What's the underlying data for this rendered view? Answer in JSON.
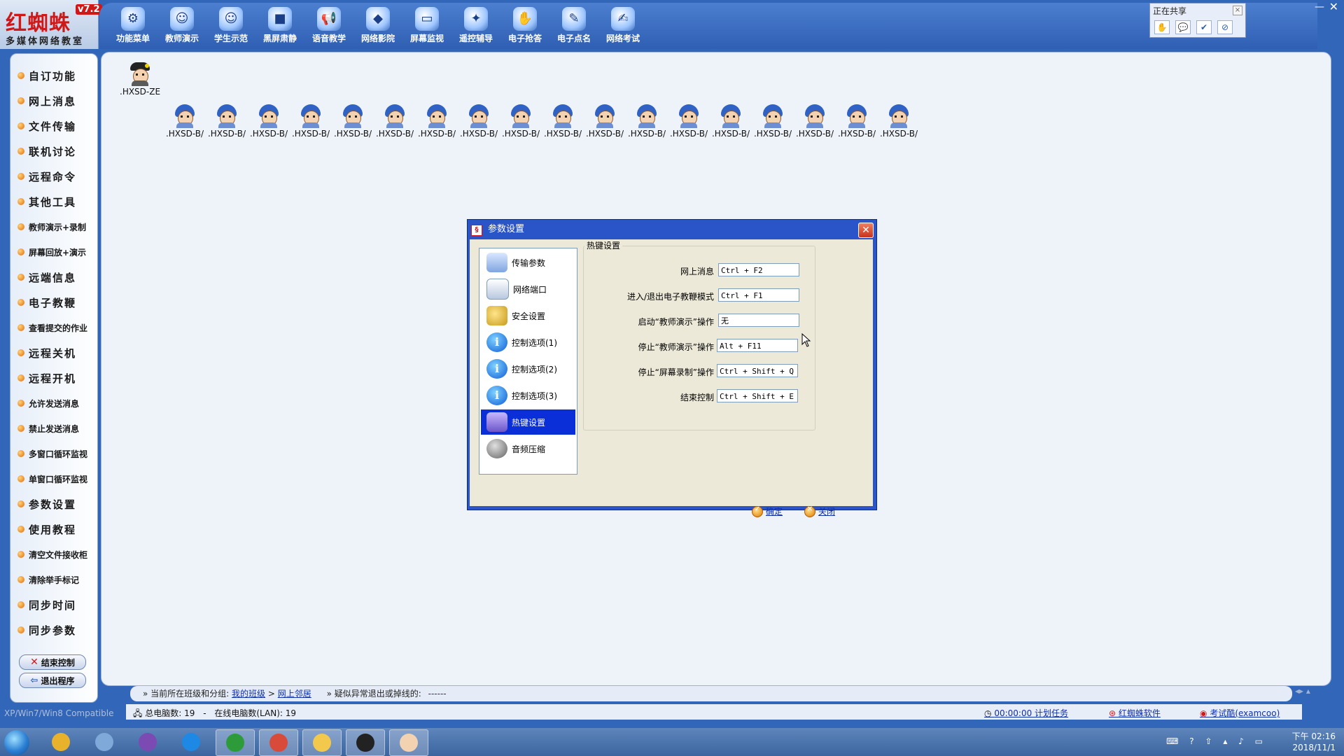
{
  "brand": {
    "title": "红蜘蛛",
    "version": "v7.2",
    "subtitle": "多媒体网络教室"
  },
  "toolbar": [
    {
      "label": "功能菜单",
      "icon": "gear-icon",
      "glyph": "⚙"
    },
    {
      "label": "教师演示",
      "icon": "teacher-icon",
      "glyph": "☺"
    },
    {
      "label": "学生示范",
      "icon": "students-icon",
      "glyph": "☺"
    },
    {
      "label": "黑屏肃静",
      "icon": "black-screen-icon",
      "glyph": "■"
    },
    {
      "label": "语音教学",
      "icon": "megaphone-icon",
      "glyph": "📢"
    },
    {
      "label": "网络影院",
      "icon": "cinema-icon",
      "glyph": "◆"
    },
    {
      "label": "屏幕监视",
      "icon": "monitor-icon",
      "glyph": "▭"
    },
    {
      "label": "遥控辅导",
      "icon": "remote-icon",
      "glyph": "✦"
    },
    {
      "label": "电子抢答",
      "icon": "buzzer-icon",
      "glyph": "✋"
    },
    {
      "label": "电子点名",
      "icon": "rollcall-icon",
      "glyph": "✎"
    },
    {
      "label": "网络考试",
      "icon": "exam-icon",
      "glyph": "✍"
    }
  ],
  "share_panel": {
    "title": "正在共享"
  },
  "sidebar": {
    "items": [
      {
        "label": "自订功能",
        "small": false
      },
      {
        "label": "网上消息",
        "small": false
      },
      {
        "label": "文件传输",
        "small": false
      },
      {
        "label": "联机讨论",
        "small": false
      },
      {
        "label": "远程命令",
        "small": false
      },
      {
        "label": "其他工具",
        "small": false
      },
      {
        "label": "教师演示+录制",
        "small": true
      },
      {
        "label": "屏幕回放+演示",
        "small": true
      },
      {
        "label": "远端信息",
        "small": false
      },
      {
        "label": "电子教鞭",
        "small": false
      },
      {
        "label": "查看提交的作业",
        "small": true
      },
      {
        "label": "远程关机",
        "small": false
      },
      {
        "label": "远程开机",
        "small": false
      },
      {
        "label": "允许发送消息",
        "small": true
      },
      {
        "label": "禁止发送消息",
        "small": true
      },
      {
        "label": "多窗口循环监视",
        "small": true
      },
      {
        "label": "单窗口循环监视",
        "small": true
      },
      {
        "label": "参数设置",
        "small": false
      },
      {
        "label": "使用教程",
        "small": false
      },
      {
        "label": "清空文件接收柜",
        "small": true
      },
      {
        "label": "清除举手标记",
        "small": true
      },
      {
        "label": "同步时间",
        "small": false
      },
      {
        "label": "同步参数",
        "small": false
      }
    ],
    "end_control": "结束控制",
    "exit_program": "退出程序"
  },
  "workspace": {
    "teacher_name": ".HXSD-ZEF",
    "student_names": [
      ".HXSD-B/",
      ".HXSD-B/",
      ".HXSD-B/",
      ".HXSD-B/",
      ".HXSD-B/",
      ".HXSD-B/",
      ".HXSD-B/",
      ".HXSD-B/",
      ".HXSD-B/",
      ".HXSD-B/",
      ".HXSD-B/",
      ".HXSD-B/",
      ".HXSD-B/",
      ".HXSD-B/",
      ".HXSD-B/",
      ".HXSD-B/",
      ".HXSD-B/",
      ".HXSD-B/"
    ]
  },
  "dialog": {
    "title": "参数设置",
    "nav": [
      {
        "label": "传输参数",
        "icon": "network-params-icon",
        "cls": "i-net",
        "glyph": ""
      },
      {
        "label": "网络端口",
        "icon": "network-port-icon",
        "cls": "i-port",
        "glyph": ""
      },
      {
        "label": "安全设置",
        "icon": "security-key-icon",
        "cls": "i-key",
        "glyph": ""
      },
      {
        "label": "控制选项(1)",
        "icon": "info-icon",
        "cls": "i-info",
        "glyph": "i"
      },
      {
        "label": "控制选项(2)",
        "icon": "info-icon",
        "cls": "i-info",
        "glyph": "i"
      },
      {
        "label": "控制选项(3)",
        "icon": "info-icon",
        "cls": "i-info",
        "glyph": "i"
      },
      {
        "label": "热键设置",
        "icon": "hotkey-icon",
        "cls": "i-hot",
        "glyph": ""
      },
      {
        "label": "音频压缩",
        "icon": "audio-icon",
        "cls": "i-audio",
        "glyph": ""
      }
    ],
    "selected_nav": "热键设置",
    "group_caption": "热键设置",
    "hotkeys": [
      {
        "label": "网上消息",
        "value": "Ctrl + F2"
      },
      {
        "label": "进入/退出电子教鞭模式",
        "value": "Ctrl + F1"
      },
      {
        "label": "启动“教师演示”操作",
        "value": "无"
      },
      {
        "label": "停止“教师演示”操作",
        "value": "Alt + F11"
      },
      {
        "label": "停止“屏幕录制”操作",
        "value": "Ctrl + Shift + Q"
      },
      {
        "label": "结束控制",
        "value": "Ctrl + Shift + E"
      }
    ],
    "ok_label": "确定",
    "close_label": "关闭"
  },
  "info_bar": {
    "prefix": "» 当前所在班级和分组:",
    "class_link": "我的班级",
    "sep": ">",
    "group_link": "网上邻居",
    "abnormal_label": "» 疑似异常退出或掉线的:",
    "abnormal_value": "------"
  },
  "status": {
    "compat": "XP/Win7/Win8 Compatible",
    "total_label": "总电脑数: 19",
    "dash": "-",
    "online_label": "在线电脑数(LAN): 19",
    "timer": "00:00:00 计划任务",
    "brand_link": "红蜘蛛软件",
    "exam_link": "考试酷(examcoo)"
  },
  "taskbar": {
    "apps": [
      {
        "name": "chrome-app",
        "color": "#e9b22c"
      },
      {
        "name": "explorer-app",
        "color": "#7ea9d8"
      },
      {
        "name": "visual-studio-app",
        "color": "#7b4ab3"
      },
      {
        "name": "maps-app",
        "color": "#1e88e5"
      },
      {
        "name": "wave-app",
        "color": "#2e9b3a"
      },
      {
        "name": "chrome-app-2",
        "color": "#d84a3a"
      },
      {
        "name": "folder-app",
        "color": "#f2c94c"
      },
      {
        "name": "unreal-app",
        "color": "#222222"
      },
      {
        "name": "redspider-app",
        "color": "#f2d2b0"
      }
    ],
    "time": "下午 02:16",
    "date": "2018/11/1"
  }
}
